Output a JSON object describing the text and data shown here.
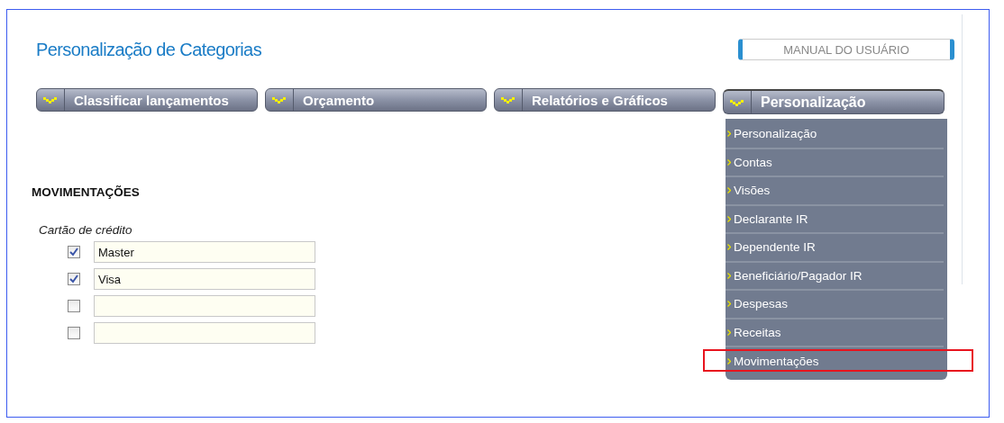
{
  "title": "Personalização de Categorias",
  "manual_button": "MANUAL DO USUÁRIO",
  "tabs": [
    {
      "label": "Classificar lançamentos",
      "selected": false
    },
    {
      "label": "Orçamento",
      "selected": false
    },
    {
      "label": "Relatórios e Gráficos",
      "selected": false
    },
    {
      "label": "Personalização",
      "selected": true
    }
  ],
  "menu": {
    "items": [
      {
        "label": "Personalização",
        "highlighted": false
      },
      {
        "label": "Contas",
        "highlighted": false
      },
      {
        "label": "Visões",
        "highlighted": false
      },
      {
        "label": "Declarante IR",
        "highlighted": false
      },
      {
        "label": "Dependente IR",
        "highlighted": false
      },
      {
        "label": "Beneficiário/Pagador IR",
        "highlighted": false
      },
      {
        "label": "Despesas",
        "highlighted": false
      },
      {
        "label": "Receitas",
        "highlighted": false
      },
      {
        "label": "Movimentações",
        "highlighted": true
      }
    ]
  },
  "section": {
    "title": "MOVIMENTAÇÕES",
    "group_label": "Cartão de crédito",
    "rows": [
      {
        "checked": true,
        "value": "Master"
      },
      {
        "checked": true,
        "value": "Visa"
      },
      {
        "checked": false,
        "value": ""
      },
      {
        "checked": false,
        "value": ""
      }
    ]
  }
}
